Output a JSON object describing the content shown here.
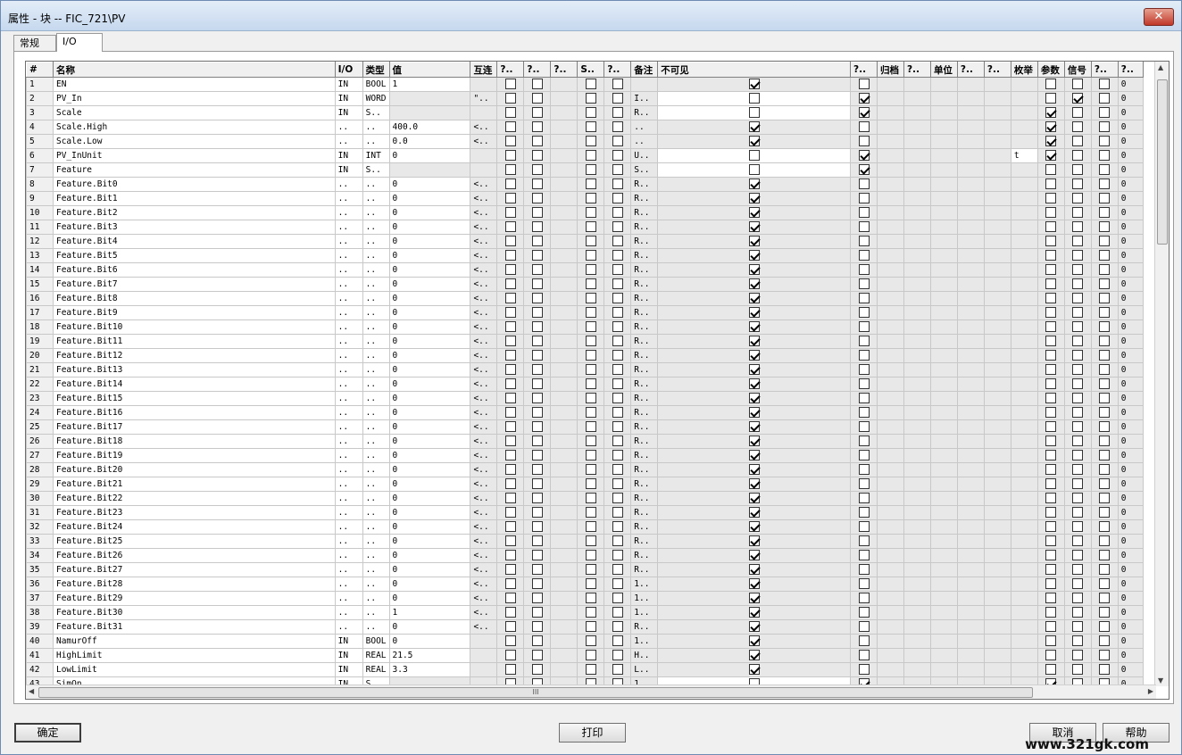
{
  "window": {
    "title": "属性 - 块 -- FIC_721\\PV",
    "close_label": "✕"
  },
  "tabs": [
    {
      "label": "常规"
    },
    {
      "label": "I/O"
    }
  ],
  "columns": [
    "#",
    "名称",
    "I/O",
    "类型",
    "值",
    "互连",
    "?..",
    "?..",
    "?..",
    "S..",
    "?..",
    "备注",
    "不可见",
    "?..",
    "归档",
    "?..",
    "单位",
    "?..",
    "?..",
    "枚举",
    "参数",
    "信号",
    "?..",
    "?.."
  ],
  "rows": [
    {
      "n": "1",
      "name": "EN",
      "io": "IN",
      "type": "BOOL",
      "val": "1",
      "link": "",
      "note": "",
      "inv": 1,
      "c13": 0,
      "enumv": "",
      "param": 0,
      "signal": 0
    },
    {
      "n": "2",
      "name": "PV_In",
      "io": "IN",
      "type": "WORD",
      "val": "",
      "link": "\"..",
      "note": "I..",
      "inv": 0,
      "c13": 1,
      "enumv": "",
      "param": 0,
      "signal": 1
    },
    {
      "n": "3",
      "name": "Scale",
      "io": "IN",
      "type": "S..",
      "val": "",
      "link": "",
      "note": "R..",
      "inv": 0,
      "c13": 1,
      "enumv": "",
      "param": 1,
      "signal": 0
    },
    {
      "n": "4",
      "name": "Scale.High",
      "io": "..",
      "type": "..",
      "val": "400.0",
      "link": "<..",
      "note": "..",
      "inv": 1,
      "c13": 0,
      "enumv": "",
      "param": 1,
      "signal": 0
    },
    {
      "n": "5",
      "name": "Scale.Low",
      "io": "..",
      "type": "..",
      "val": "0.0",
      "link": "<..",
      "note": "..",
      "inv": 1,
      "c13": 0,
      "enumv": "",
      "param": 1,
      "signal": 0
    },
    {
      "n": "6",
      "name": "PV_InUnit",
      "io": "IN",
      "type": "INT",
      "val": "0",
      "link": "",
      "note": "U..",
      "inv": 0,
      "c13": 1,
      "enumv": "t",
      "param": 1,
      "signal": 0
    },
    {
      "n": "7",
      "name": "Feature",
      "io": "IN",
      "type": "S..",
      "val": "",
      "link": "",
      "note": "S..",
      "inv": 0,
      "c13": 1,
      "enumv": "",
      "param": 0,
      "signal": 0
    },
    {
      "n": "8",
      "name": "Feature.Bit0",
      "io": "..",
      "type": "..",
      "val": "0",
      "link": "<..",
      "note": "R..",
      "inv": 1,
      "c13": 0,
      "enumv": "",
      "param": 0,
      "signal": 0
    },
    {
      "n": "9",
      "name": "Feature.Bit1",
      "io": "..",
      "type": "..",
      "val": "0",
      "link": "<..",
      "note": "R..",
      "inv": 1,
      "c13": 0,
      "enumv": "",
      "param": 0,
      "signal": 0
    },
    {
      "n": "10",
      "name": "Feature.Bit2",
      "io": "..",
      "type": "..",
      "val": "0",
      "link": "<..",
      "note": "R..",
      "inv": 1,
      "c13": 0,
      "enumv": "",
      "param": 0,
      "signal": 0
    },
    {
      "n": "11",
      "name": "Feature.Bit3",
      "io": "..",
      "type": "..",
      "val": "0",
      "link": "<..",
      "note": "R..",
      "inv": 1,
      "c13": 0,
      "enumv": "",
      "param": 0,
      "signal": 0
    },
    {
      "n": "12",
      "name": "Feature.Bit4",
      "io": "..",
      "type": "..",
      "val": "0",
      "link": "<..",
      "note": "R..",
      "inv": 1,
      "c13": 0,
      "enumv": "",
      "param": 0,
      "signal": 0
    },
    {
      "n": "13",
      "name": "Feature.Bit5",
      "io": "..",
      "type": "..",
      "val": "0",
      "link": "<..",
      "note": "R..",
      "inv": 1,
      "c13": 0,
      "enumv": "",
      "param": 0,
      "signal": 0
    },
    {
      "n": "14",
      "name": "Feature.Bit6",
      "io": "..",
      "type": "..",
      "val": "0",
      "link": "<..",
      "note": "R..",
      "inv": 1,
      "c13": 0,
      "enumv": "",
      "param": 0,
      "signal": 0
    },
    {
      "n": "15",
      "name": "Feature.Bit7",
      "io": "..",
      "type": "..",
      "val": "0",
      "link": "<..",
      "note": "R..",
      "inv": 1,
      "c13": 0,
      "enumv": "",
      "param": 0,
      "signal": 0
    },
    {
      "n": "16",
      "name": "Feature.Bit8",
      "io": "..",
      "type": "..",
      "val": "0",
      "link": "<..",
      "note": "R..",
      "inv": 1,
      "c13": 0,
      "enumv": "",
      "param": 0,
      "signal": 0
    },
    {
      "n": "17",
      "name": "Feature.Bit9",
      "io": "..",
      "type": "..",
      "val": "0",
      "link": "<..",
      "note": "R..",
      "inv": 1,
      "c13": 0,
      "enumv": "",
      "param": 0,
      "signal": 0
    },
    {
      "n": "18",
      "name": "Feature.Bit10",
      "io": "..",
      "type": "..",
      "val": "0",
      "link": "<..",
      "note": "R..",
      "inv": 1,
      "c13": 0,
      "enumv": "",
      "param": 0,
      "signal": 0
    },
    {
      "n": "19",
      "name": "Feature.Bit11",
      "io": "..",
      "type": "..",
      "val": "0",
      "link": "<..",
      "note": "R..",
      "inv": 1,
      "c13": 0,
      "enumv": "",
      "param": 0,
      "signal": 0
    },
    {
      "n": "20",
      "name": "Feature.Bit12",
      "io": "..",
      "type": "..",
      "val": "0",
      "link": "<..",
      "note": "R..",
      "inv": 1,
      "c13": 0,
      "enumv": "",
      "param": 0,
      "signal": 0
    },
    {
      "n": "21",
      "name": "Feature.Bit13",
      "io": "..",
      "type": "..",
      "val": "0",
      "link": "<..",
      "note": "R..",
      "inv": 1,
      "c13": 0,
      "enumv": "",
      "param": 0,
      "signal": 0
    },
    {
      "n": "22",
      "name": "Feature.Bit14",
      "io": "..",
      "type": "..",
      "val": "0",
      "link": "<..",
      "note": "R..",
      "inv": 1,
      "c13": 0,
      "enumv": "",
      "param": 0,
      "signal": 0
    },
    {
      "n": "23",
      "name": "Feature.Bit15",
      "io": "..",
      "type": "..",
      "val": "0",
      "link": "<..",
      "note": "R..",
      "inv": 1,
      "c13": 0,
      "enumv": "",
      "param": 0,
      "signal": 0
    },
    {
      "n": "24",
      "name": "Feature.Bit16",
      "io": "..",
      "type": "..",
      "val": "0",
      "link": "<..",
      "note": "R..",
      "inv": 1,
      "c13": 0,
      "enumv": "",
      "param": 0,
      "signal": 0
    },
    {
      "n": "25",
      "name": "Feature.Bit17",
      "io": "..",
      "type": "..",
      "val": "0",
      "link": "<..",
      "note": "R..",
      "inv": 1,
      "c13": 0,
      "enumv": "",
      "param": 0,
      "signal": 0
    },
    {
      "n": "26",
      "name": "Feature.Bit18",
      "io": "..",
      "type": "..",
      "val": "0",
      "link": "<..",
      "note": "R..",
      "inv": 1,
      "c13": 0,
      "enumv": "",
      "param": 0,
      "signal": 0
    },
    {
      "n": "27",
      "name": "Feature.Bit19",
      "io": "..",
      "type": "..",
      "val": "0",
      "link": "<..",
      "note": "R..",
      "inv": 1,
      "c13": 0,
      "enumv": "",
      "param": 0,
      "signal": 0
    },
    {
      "n": "28",
      "name": "Feature.Bit20",
      "io": "..",
      "type": "..",
      "val": "0",
      "link": "<..",
      "note": "R..",
      "inv": 1,
      "c13": 0,
      "enumv": "",
      "param": 0,
      "signal": 0
    },
    {
      "n": "29",
      "name": "Feature.Bit21",
      "io": "..",
      "type": "..",
      "val": "0",
      "link": "<..",
      "note": "R..",
      "inv": 1,
      "c13": 0,
      "enumv": "",
      "param": 0,
      "signal": 0
    },
    {
      "n": "30",
      "name": "Feature.Bit22",
      "io": "..",
      "type": "..",
      "val": "0",
      "link": "<..",
      "note": "R..",
      "inv": 1,
      "c13": 0,
      "enumv": "",
      "param": 0,
      "signal": 0
    },
    {
      "n": "31",
      "name": "Feature.Bit23",
      "io": "..",
      "type": "..",
      "val": "0",
      "link": "<..",
      "note": "R..",
      "inv": 1,
      "c13": 0,
      "enumv": "",
      "param": 0,
      "signal": 0
    },
    {
      "n": "32",
      "name": "Feature.Bit24",
      "io": "..",
      "type": "..",
      "val": "0",
      "link": "<..",
      "note": "R..",
      "inv": 1,
      "c13": 0,
      "enumv": "",
      "param": 0,
      "signal": 0
    },
    {
      "n": "33",
      "name": "Feature.Bit25",
      "io": "..",
      "type": "..",
      "val": "0",
      "link": "<..",
      "note": "R..",
      "inv": 1,
      "c13": 0,
      "enumv": "",
      "param": 0,
      "signal": 0
    },
    {
      "n": "34",
      "name": "Feature.Bit26",
      "io": "..",
      "type": "..",
      "val": "0",
      "link": "<..",
      "note": "R..",
      "inv": 1,
      "c13": 0,
      "enumv": "",
      "param": 0,
      "signal": 0
    },
    {
      "n": "35",
      "name": "Feature.Bit27",
      "io": "..",
      "type": "..",
      "val": "0",
      "link": "<..",
      "note": "R..",
      "inv": 1,
      "c13": 0,
      "enumv": "",
      "param": 0,
      "signal": 0
    },
    {
      "n": "36",
      "name": "Feature.Bit28",
      "io": "..",
      "type": "..",
      "val": "0",
      "link": "<..",
      "note": "1..",
      "inv": 1,
      "c13": 0,
      "enumv": "",
      "param": 0,
      "signal": 0
    },
    {
      "n": "37",
      "name": "Feature.Bit29",
      "io": "..",
      "type": "..",
      "val": "0",
      "link": "<..",
      "note": "1..",
      "inv": 1,
      "c13": 0,
      "enumv": "",
      "param": 0,
      "signal": 0
    },
    {
      "n": "38",
      "name": "Feature.Bit30",
      "io": "..",
      "type": "..",
      "val": "1",
      "link": "<..",
      "note": "1..",
      "inv": 1,
      "c13": 0,
      "enumv": "",
      "param": 0,
      "signal": 0
    },
    {
      "n": "39",
      "name": "Feature.Bit31",
      "io": "..",
      "type": "..",
      "val": "0",
      "link": "<..",
      "note": "R..",
      "inv": 1,
      "c13": 0,
      "enumv": "",
      "param": 0,
      "signal": 0
    },
    {
      "n": "40",
      "name": "NamurOff",
      "io": "IN",
      "type": "BOOL",
      "val": "0",
      "link": "",
      "note": "1..",
      "inv": 1,
      "c13": 0,
      "enumv": "",
      "param": 0,
      "signal": 0
    },
    {
      "n": "41",
      "name": "HighLimit",
      "io": "IN",
      "type": "REAL",
      "val": "21.5",
      "link": "",
      "note": "H..",
      "inv": 1,
      "c13": 0,
      "enumv": "",
      "param": 0,
      "signal": 0
    },
    {
      "n": "42",
      "name": "LowLimit",
      "io": "IN",
      "type": "REAL",
      "val": "3.3",
      "link": "",
      "note": "L..",
      "inv": 1,
      "c13": 0,
      "enumv": "",
      "param": 0,
      "signal": 0
    },
    {
      "n": "43",
      "name": "SimOn",
      "io": "IN",
      "type": "S..",
      "val": "",
      "link": "",
      "note": "1..",
      "inv": 0,
      "c13": 1,
      "enumv": "",
      "param": 1,
      "signal": 0
    }
  ],
  "last_col_value": "0",
  "hscroll_grip": "III",
  "buttons": {
    "ok": "确定",
    "print": "打印",
    "cancel": "取消",
    "help": "帮助"
  },
  "watermark": "www.321gk.com"
}
